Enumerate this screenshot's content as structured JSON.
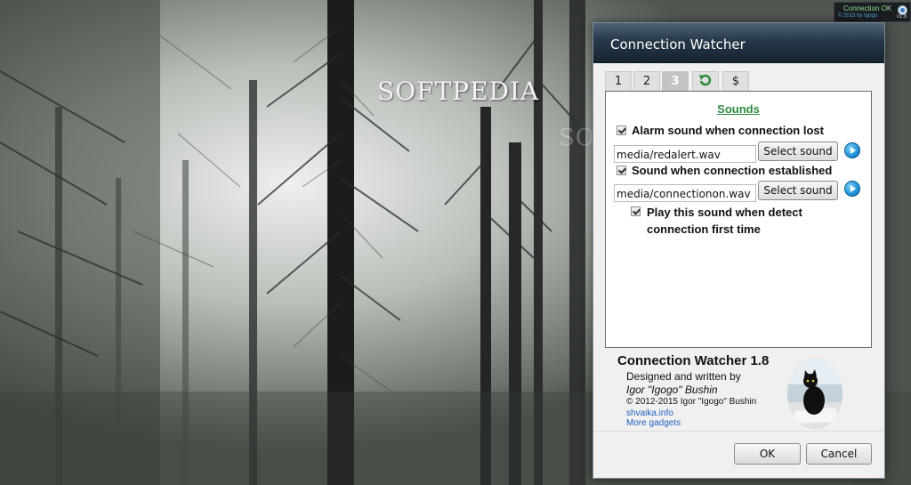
{
  "desktop": {
    "watermark": "SOFTPEDIA",
    "watermark_faint": "SOFTPEDIA",
    "tray": {
      "status": "Connection OK",
      "copyright": "© 2015 by Igogo",
      "version": "v1.8"
    }
  },
  "dialog": {
    "title": "Connection Watcher",
    "tabs": [
      {
        "label": "1"
      },
      {
        "label": "2"
      },
      {
        "label": "3"
      },
      {
        "label": "",
        "icon": "refresh-icon"
      },
      {
        "label": "$"
      }
    ],
    "active_tab": "3",
    "sounds": {
      "heading": "Sounds",
      "alarm_lost": {
        "label": "Alarm sound when connection lost",
        "checked": true,
        "path": "media/redalert.wav"
      },
      "established": {
        "label": "Sound when connection established",
        "checked": true,
        "path": "media/connectionon.wav"
      },
      "first_time": {
        "label_line1": "Play this sound when detect",
        "label_line2": "connection first time",
        "checked": true
      },
      "select_label": "Select sound"
    },
    "about": {
      "title": "Connection Watcher 1.8",
      "designed": "Designed and written by",
      "author": "Igor \"Igogo\" Bushin",
      "copyright": "© 2012-2015 Igor \"Igogo\" Bushin",
      "site": "shvaika.info",
      "more": "More gadgets"
    },
    "buttons": {
      "ok": "OK",
      "cancel": "Cancel"
    }
  },
  "colors": {
    "accent_green": "#2d8a3e",
    "link_blue": "#1f5fbf",
    "play_blue": "#1e92d6",
    "title_bar": "#26384a"
  }
}
